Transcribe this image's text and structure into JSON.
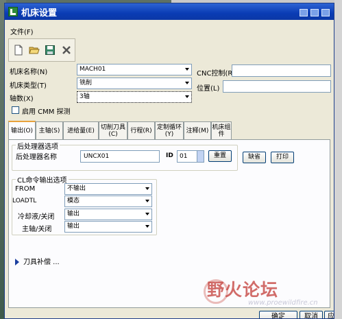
{
  "window": {
    "title": "机床设置"
  },
  "menu": {
    "file": "文件(F)"
  },
  "toolbar": {
    "icons": [
      "new-document-icon",
      "open-folder-icon",
      "save-disk-icon",
      "delete-x-icon"
    ]
  },
  "form": {
    "machine_name_label": "机床名称(N)",
    "machine_name_value": "MACH01",
    "machine_type_label": "机床类型(T)",
    "machine_type_value": "铣削",
    "axes_label": "轴数(X)",
    "axes_value": "3轴",
    "cnc_label": "CNC控制(R)",
    "cnc_value": "",
    "location_label": "位置(L)",
    "location_value": "",
    "cmm_label": "启用 CMM 探测",
    "cmm_checked": false
  },
  "tabs": [
    "输出(O)",
    "主轴(S)",
    "进给量(E)",
    "切削刀具(C)",
    "行程(R)",
    "定制循环(Y)",
    "注释(M)",
    "机床组件"
  ],
  "output_tab": {
    "postprocessor_group": "后处理器选项",
    "postprocessor_name_label": "后处理器名称",
    "postprocessor_name_value": "UNCX01",
    "id_label": "ID",
    "id_value": "01",
    "reset_button": "重置",
    "default_button": "缺省",
    "print_button": "打印",
    "cl_group": "CL命令输出选项",
    "rows": [
      {
        "label": "FROM",
        "value": "不输出"
      },
      {
        "label": "LOADTL",
        "value": "模态"
      },
      {
        "label": "冷却液/关闭",
        "value": "输出"
      },
      {
        "label": "主轴/关闭",
        "value": "输出"
      }
    ],
    "tool_comp_label": "刀具补偿 ..."
  },
  "buttons": {
    "ok": "确定",
    "cancel": "取消",
    "apply": "应用"
  },
  "watermark": {
    "text": "野火论坛",
    "url": "www.proewildfire.cn"
  },
  "colors": {
    "titlebar": "#0a3cb4",
    "active_tab": "#e8a23b",
    "watermark": "#c33d38"
  }
}
